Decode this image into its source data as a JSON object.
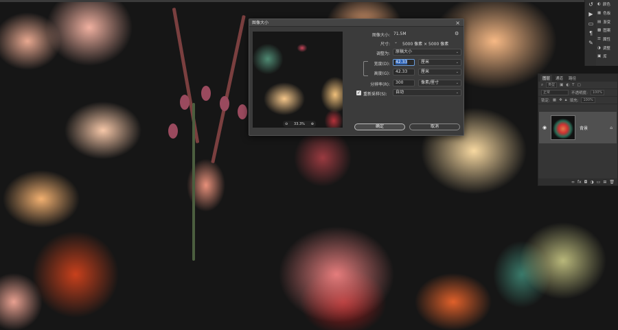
{
  "tools": {
    "icons": [
      "history-icon",
      "play-icon",
      "comment-icon",
      "text-paragraph-icon",
      "brush-settings-icon"
    ]
  },
  "right_panel": {
    "items": [
      {
        "icon": "eye-icon",
        "label": "颜色"
      },
      {
        "icon": "grid-icon",
        "label": "色板"
      },
      {
        "icon": "gradient-icon",
        "label": "渐变"
      },
      {
        "icon": "pattern-icon",
        "label": "图案"
      },
      {
        "icon": "properties-icon",
        "label": "属性"
      },
      {
        "icon": "adjust-icon",
        "label": "调整"
      },
      {
        "icon": "library-icon",
        "label": "库"
      }
    ]
  },
  "dialog": {
    "title": "图像大小",
    "image_size_label": "图像大小:",
    "image_size_value": "71.5M",
    "dimensions_label": "尺寸:",
    "dimensions_value": "5000 像素 × 5000 像素",
    "fit_to_label": "调整为:",
    "fit_to_value": "原稿大小",
    "width_label": "宽度(D):",
    "width_value": "42.33",
    "width_unit": "厘米",
    "height_label": "高度(G):",
    "height_value": "42.33",
    "height_unit": "厘米",
    "resolution_label": "分辨率(R):",
    "resolution_value": "300",
    "resolution_unit": "像素/厘寸",
    "resample_label": "重新采样(S):",
    "resample_value": "自动",
    "resample_checked": true,
    "zoom_value": "33.3%",
    "ok_label": "确定",
    "cancel_label": "取消"
  },
  "layers_panel": {
    "tabs": [
      "图层",
      "通道",
      "路径"
    ],
    "active_tab": "图层",
    "search_placeholder": "类型",
    "blend_mode": "正常",
    "opacity_label": "不透明度:",
    "opacity_value": "100%",
    "lock_label": "锁定:",
    "fill_label": "填充:",
    "fill_value": "100%",
    "layer_name": "背景"
  }
}
